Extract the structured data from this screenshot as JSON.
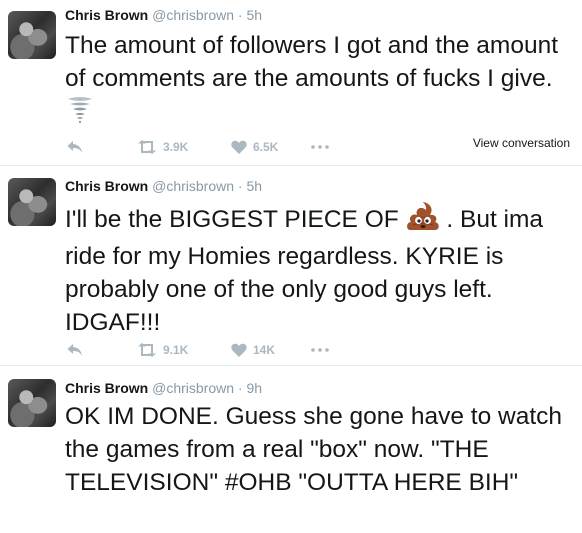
{
  "tweets": [
    {
      "name": "Chris Brown",
      "handle": "@chrisbrown",
      "separator": "·",
      "time": "5h",
      "text": "The amount of followers I got and the amount of comments are the amounts of fucks I give.",
      "emoji": "tornado-emoji",
      "retweets": "3.9K",
      "likes": "6.5K",
      "view_conversation": "View conversation"
    },
    {
      "name": "Chris Brown",
      "handle": "@chrisbrown",
      "separator": "·",
      "time": "5h",
      "text_before": "I'll be the BIGGEST PIECE OF",
      "emoji": "poop-emoji",
      "text_after": ". But ima ride for my Homies regardless. KYRIE is probably one of the only good guys left. IDGAF!!!",
      "retweets": "9.1K",
      "likes": "14K"
    },
    {
      "name": "Chris Brown",
      "handle": "@chrisbrown",
      "separator": "·",
      "time": "9h",
      "text": "OK IM DONE. Guess she gone have to watch the games from a real \"box\" now. \"THE TELEVISION\" #OHB \"OUTTA HERE BIH\""
    }
  ],
  "colors": {
    "text": "#14171a",
    "muted": "#8899a6",
    "action_gray": "#aab8c2",
    "divider": "#e6ecf0"
  }
}
